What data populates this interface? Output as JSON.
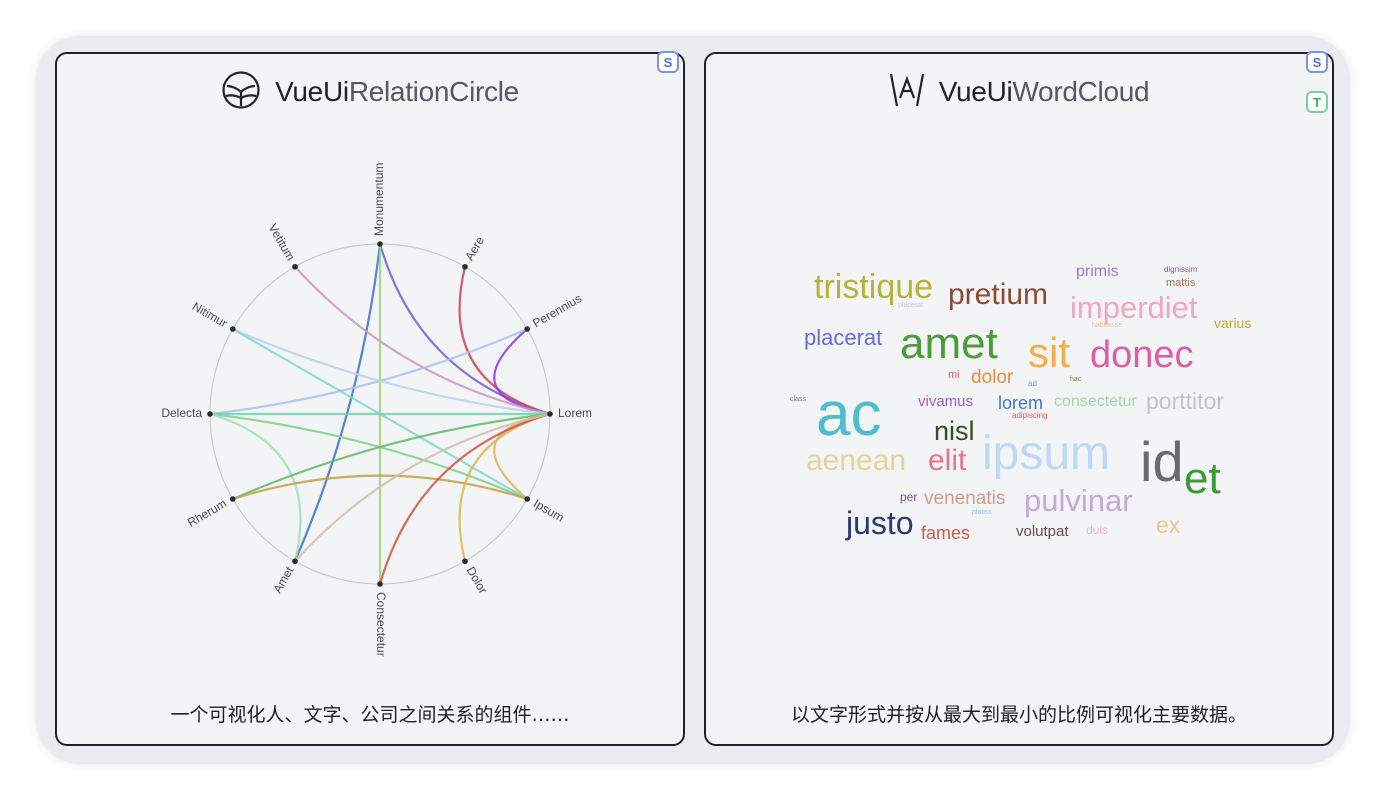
{
  "cards": [
    {
      "title_prefix": "VueUi",
      "title_rest": "RelationCircle",
      "description": "一个可视化人、文字、公司之间关系的组件……",
      "badges": [
        "S"
      ]
    },
    {
      "title_prefix": "VueUi",
      "title_rest": "WordCloud",
      "description": "以文字形式并按从最大到最小的比例可视化主要数据。",
      "badges": [
        "S",
        "T"
      ]
    }
  ],
  "chart_data": [
    {
      "type": "relation-circle",
      "nodes": [
        "Monumentum",
        "Aere",
        "Perennius",
        "Lorem",
        "Ipsum",
        "Dolor",
        "Consectetur",
        "Amet",
        "Rherum",
        "Delecta",
        "Nitimur",
        "Vetitum"
      ],
      "links": [
        {
          "from": "Monumentum",
          "to": "Lorem",
          "color": "#6e5fd6"
        },
        {
          "from": "Monumentum",
          "to": "Amet",
          "color": "#3a6fd0"
        },
        {
          "from": "Monumentum",
          "to": "Consectetur",
          "color": "#9bd17a"
        },
        {
          "from": "Aere",
          "to": "Lorem",
          "color": "#d2404d"
        },
        {
          "from": "Perennius",
          "to": "Lorem",
          "color": "#8a35e0"
        },
        {
          "from": "Perennius",
          "to": "Delecta",
          "color": "#a8c0f0"
        },
        {
          "from": "Vetitum",
          "to": "Lorem",
          "color": "#c89ab8"
        },
        {
          "from": "Nitimur",
          "to": "Lorem",
          "color": "#b8d0ec"
        },
        {
          "from": "Nitimur",
          "to": "Ipsum",
          "color": "#7fd8c8"
        },
        {
          "from": "Delecta",
          "to": "Lorem",
          "color": "#70d2a8"
        },
        {
          "from": "Delecta",
          "to": "Ipsum",
          "color": "#7ed08a"
        },
        {
          "from": "Delecta",
          "to": "Amet",
          "color": "#a0e0b8"
        },
        {
          "from": "Rherum",
          "to": "Lorem",
          "color": "#5fba6a"
        },
        {
          "from": "Rherum",
          "to": "Ipsum",
          "color": "#c2a040"
        },
        {
          "from": "Lorem",
          "to": "Ipsum",
          "color": "#e3b050"
        },
        {
          "from": "Lorem",
          "to": "Dolor",
          "color": "#d6b84a"
        },
        {
          "from": "Lorem",
          "to": "Consectetur",
          "color": "#d6503c"
        },
        {
          "from": "Lorem",
          "to": "Amet",
          "color": "#d0c0a8"
        }
      ]
    },
    {
      "type": "word-cloud",
      "words": [
        {
          "text": "tristique",
          "size": 34,
          "color": "#b5b534"
        },
        {
          "text": "pretium",
          "size": 30,
          "color": "#8c4a3a"
        },
        {
          "text": "primis",
          "size": 16,
          "color": "#9d7bd0"
        },
        {
          "text": "dignissim",
          "size": 8,
          "color": "#8b5fa8"
        },
        {
          "text": "mattis",
          "size": 11,
          "color": "#a07a50"
        },
        {
          "text": "imperdiet",
          "size": 31,
          "color": "#f2a6bf"
        },
        {
          "text": "placerat",
          "size": 22,
          "color": "#6a6ad6"
        },
        {
          "text": "amet",
          "size": 44,
          "color": "#4c9c38"
        },
        {
          "text": "sit",
          "size": 42,
          "color": "#f4ad4a"
        },
        {
          "text": "donec",
          "size": 38,
          "color": "#e05aa6"
        },
        {
          "text": "varius",
          "size": 14,
          "color": "#b5ad3e"
        },
        {
          "text": "dolor",
          "size": 19,
          "color": "#f08a3a"
        },
        {
          "text": "mi",
          "size": 11,
          "color": "#e45a6a"
        },
        {
          "text": "ac",
          "size": 62,
          "color": "#4fbcd0"
        },
        {
          "text": "vivamus",
          "size": 15,
          "color": "#9e60c8"
        },
        {
          "text": "lorem",
          "size": 18,
          "color": "#4078c8"
        },
        {
          "text": "consectetur",
          "size": 16,
          "color": "#9ed8a8"
        },
        {
          "text": "porttitor",
          "size": 23,
          "color": "#c4c4c4"
        },
        {
          "text": "nisl",
          "size": 27,
          "color": "#3a4a2c"
        },
        {
          "text": "aenean",
          "size": 30,
          "color": "#e0d59a"
        },
        {
          "text": "elit",
          "size": 30,
          "color": "#e8738a"
        },
        {
          "text": "ipsum",
          "size": 48,
          "color": "#c0d8f4"
        },
        {
          "text": "id",
          "size": 56,
          "color": "#6b6b6b"
        },
        {
          "text": "et",
          "size": 44,
          "color": "#3a9a34"
        },
        {
          "text": "per",
          "size": 12,
          "color": "#7a4aa8"
        },
        {
          "text": "venenatis",
          "size": 19,
          "color": "#d49a8a"
        },
        {
          "text": "pulvinar",
          "size": 31,
          "color": "#c7a8d8"
        },
        {
          "text": "justo",
          "size": 32,
          "color": "#2a3a70"
        },
        {
          "text": "fames",
          "size": 18,
          "color": "#c85a50"
        },
        {
          "text": "volutpat",
          "size": 15,
          "color": "#6a4a4a"
        },
        {
          "text": "duis",
          "size": 12,
          "color": "#f2b4c8"
        },
        {
          "text": "ex",
          "size": 23,
          "color": "#e6cc8a"
        },
        {
          "text": "class",
          "size": 7,
          "color": "#7a7a7a"
        },
        {
          "text": "ad",
          "size": 8,
          "color": "#6a9ad8"
        },
        {
          "text": "hac",
          "size": 7,
          "color": "#8a7a5a"
        },
        {
          "text": "adipiscing",
          "size": 8,
          "color": "#e05a5a"
        },
        {
          "text": "platea",
          "size": 7,
          "color": "#9ac8d8"
        },
        {
          "text": "habitasse",
          "size": 7,
          "color": "#e6c09a"
        },
        {
          "text": "placerat",
          "size": 7,
          "color": "#c8c8f0"
        }
      ]
    }
  ]
}
